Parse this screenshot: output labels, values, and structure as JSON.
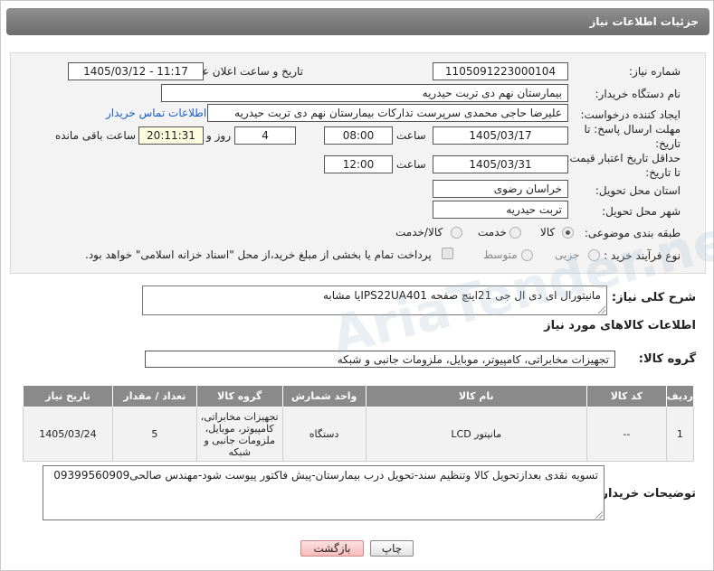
{
  "header": {
    "title": "جزئیات اطلاعات نیاز"
  },
  "form": {
    "need_number_label": "شماره نیاز:",
    "need_number": "1105091223000104",
    "announce_label": "تاریخ و ساعت اعلان عمومی:",
    "announce_value": "1405/03/12 - 11:17",
    "buyer_org_label": "نام دستگاه خریدار:",
    "buyer_org": "بیمارستان نهم دی تربت حیدریه",
    "creator_label": "ایجاد کننده درخواست:",
    "creator": "علیرضا حاجی محمدی سرپرست تدارکات بیمارستان نهم دی تربت حیدریه",
    "contact_link": "اطلاعات تماس خریدار",
    "deadline_label": "مهلت ارسال پاسخ: تا تاریخ:",
    "deadline_date": "1405/03/17",
    "time_label": "ساعت",
    "deadline_time": "08:00",
    "days_value": "4",
    "days_label": "روز و",
    "remaining_time": "20:11:31",
    "remaining_label": "ساعت باقی مانده",
    "validity_label": "حداقل تاریخ اعتبار قیمت: تا تاریخ:",
    "validity_date": "1405/03/31",
    "validity_time_label": "ساعت",
    "validity_time": "12:00",
    "province_label": "استان محل تحویل:",
    "province": "خراسان رضوی",
    "city_label": "شهر محل تحویل:",
    "city": "تربت حیدریه",
    "category_label": "طبقه بندی موضوعی:",
    "category_options": [
      "کالا",
      "خدمت",
      "کالا/خدمت"
    ],
    "category_selected": "کالا",
    "process_label": "نوع فرآیند خرید :",
    "process_options": [
      "جزیی",
      "متوسط"
    ],
    "payment_note": "پرداخت تمام یا بخشی از مبلغ خرید،از محل \"اسناد خزانه اسلامی\" خواهد بود."
  },
  "description": {
    "label": "شرح کلی نیاز:",
    "value": "مانیتورال ای دی ال جی 21اینچ صفحه IPS22UA401یا مشابه"
  },
  "goods_section": {
    "title": "اطلاعات کالاهای مورد نیاز",
    "group_label": "گروه کالا:",
    "group_value": "تجهیزات مخابراتی، کامپیوتر، موبایل، ملزومات جانبی و شبکه"
  },
  "table": {
    "headers": [
      "ردیف",
      "کد کالا",
      "نام کالا",
      "واحد شمارش",
      "گروه کالا",
      "تعداد / مقدار",
      "تاریخ نیاز"
    ],
    "rows": [
      [
        "1",
        "--",
        "مانیتور LCD",
        "دستگاه",
        "تجهیزات مخابراتی، کامپیوتر، موبایل، ملزومات جانبی و شبکه",
        "5",
        "1405/03/24"
      ]
    ]
  },
  "buyer_notes": {
    "label": "توضیحات خریدار:",
    "value": "تسویه نقدی بعدازتحویل کالا وتنظیم سند-تحویل درب بیمارستان-پیش فاکتور پیوست شود-مهندس صالحی09399560909"
  },
  "buttons": {
    "print": "چاپ",
    "back": "بازگشت"
  },
  "watermark": "AriaTender.net",
  "colors": {
    "titlebar": "#7a7a7a",
    "link": "#1a5dc8",
    "table_header": "#8a8a8a"
  }
}
